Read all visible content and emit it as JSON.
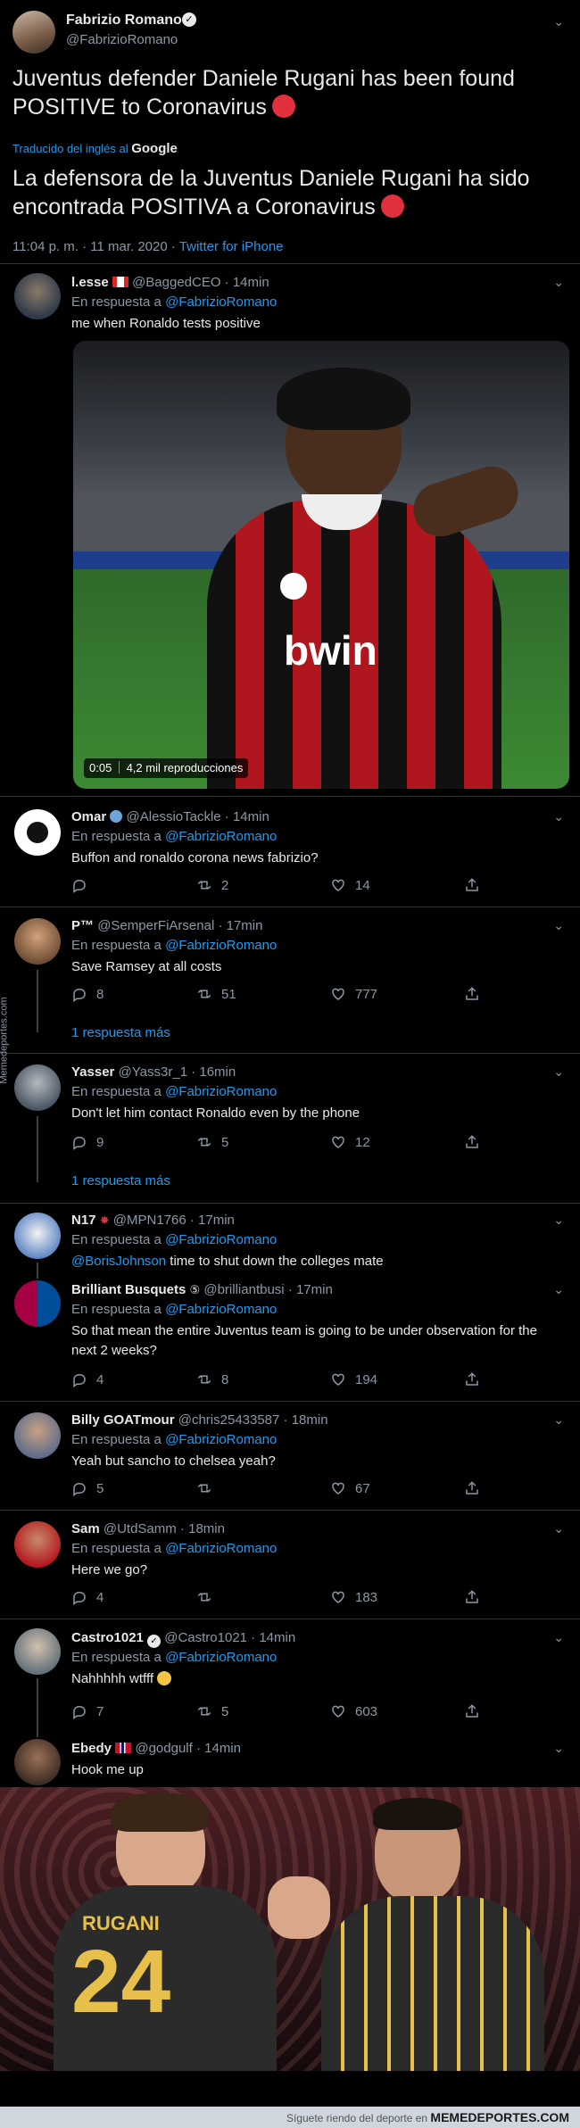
{
  "main": {
    "name": "Fabrizio Romano",
    "handle": "@FabrizioRomano",
    "text": "Juventus defender Daniele Rugani has been found POSITIVE to Coronavirus",
    "translated_from": "Traducido del inglés al",
    "translator": "Google",
    "translated_text": "La defensora de la Juventus Daniele Rugani ha sido encontrada POSITIVA a Coronavirus",
    "time": "11:04 p. m. · 11 mar. 2020",
    "source": "Twitter for iPhone"
  },
  "reply_prefix": "En respuesta a",
  "replies": [
    {
      "name": "l.esse",
      "handle": "@BaggedCEO · 14min",
      "to": "@FabrizioRomano",
      "text": "me when Ronaldo tests positive",
      "video_time": "0:05",
      "video_views": "4,2 mil reproducciones"
    },
    {
      "name": "Omar",
      "handle": "@AlessioTackle · 14min",
      "to": "@FabrizioRomano",
      "text": "Buffon and ronaldo corona news fabrizio?",
      "retweets": "2",
      "likes": "14"
    },
    {
      "name": "P™",
      "handle": "@SemperFiArsenal · 17min",
      "to": "@FabrizioRomano",
      "text": "Save Ramsey at all costs",
      "replies": "8",
      "retweets": "51",
      "likes": "777",
      "more": "1 respuesta más"
    },
    {
      "name": "Yasser",
      "handle": "@Yass3r_1 · 16min",
      "to": "@FabrizioRomano",
      "text": "Don't let him contact Ronaldo even by the phone",
      "replies": "9",
      "retweets": "5",
      "likes": "12",
      "more": "1 respuesta más"
    },
    {
      "name": "N17",
      "handle": "@MPN1766 · 17min",
      "to": "@FabrizioRomano",
      "mention": "@BorisJohnson",
      "text": " time to shut down the colleges mate"
    },
    {
      "name": "Brilliant Busquets",
      "handle": "@brilliantbusi · 17min",
      "to": "@FabrizioRomano",
      "text": "So that mean the entire Juventus team is going to be under observation for the next 2 weeks?",
      "replies": "4",
      "retweets": "8",
      "likes": "194"
    },
    {
      "name": "Billy GOATmour",
      "handle": "@chris25433587 · 18min",
      "to": "@FabrizioRomano",
      "text": "Yeah but sancho to chelsea yeah?",
      "replies": "5",
      "likes": "67"
    },
    {
      "name": "Sam",
      "handle": "@UtdSamm · 18min",
      "to": "@FabrizioRomano",
      "text": "Here we go?",
      "replies": "4",
      "likes": "183"
    },
    {
      "name": "Castro1021",
      "handle": "@Castro1021 · 14min",
      "to": "@FabrizioRomano",
      "text": "Nahhhhh wtfff",
      "replies": "7",
      "retweets": "5",
      "likes": "603"
    },
    {
      "name": "Ebedy",
      "handle": "@godgulf · 14min",
      "text": "Hook me up"
    }
  ],
  "watermark": "Memedeportes.com",
  "footer": {
    "text": "Síguete riendo del deporte en",
    "site": "MEMEDEPORTES.COM"
  }
}
